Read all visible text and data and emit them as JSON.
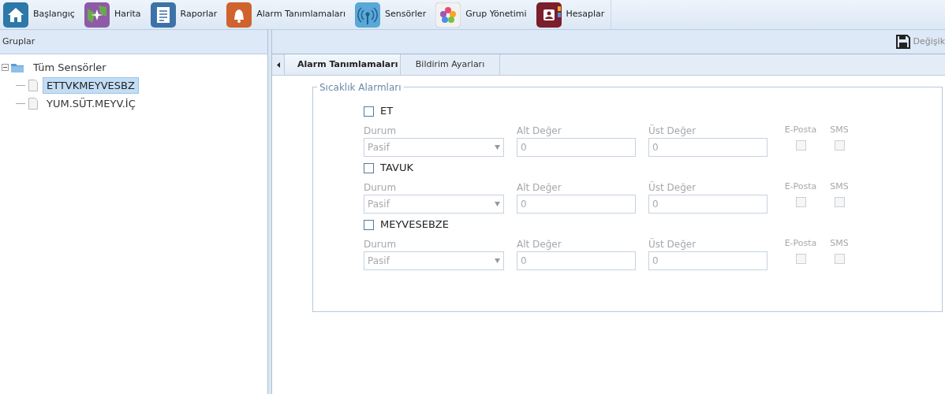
{
  "toolbar": [
    {
      "label": "Başlangıç"
    },
    {
      "label": "Harita"
    },
    {
      "label": "Raporlar"
    },
    {
      "label": "Alarm Tanımlamaları"
    },
    {
      "label": "Sensörler"
    },
    {
      "label": "Grup Yönetimi"
    },
    {
      "label": "Hesaplar"
    }
  ],
  "sidebar": {
    "title": "Gruplar",
    "tree": [
      {
        "label": "Tüm Sensörler",
        "expanded": true,
        "selected": false,
        "children": [
          {
            "label": "ETTVKMEYVESBZ",
            "selected": true
          },
          {
            "label": "YUM.SÜT.MEYV.İÇ",
            "selected": false
          }
        ]
      }
    ]
  },
  "main": {
    "save_button": "Değişik",
    "tabs": [
      {
        "label": "Alarm Tanımlamaları",
        "selected": true
      },
      {
        "label": "Bildirim Ayarları",
        "selected": false
      }
    ],
    "fieldset": {
      "legend": "Sıcaklık Alarmları",
      "groups": [
        {
          "name": "ET",
          "checked": false,
          "disabled": true,
          "status_label": "Durum",
          "status": "Pasif",
          "low_label": "Alt Değer",
          "low": "0",
          "high_label": "Üst Değer",
          "high": "0",
          "email_label": "E-Posta",
          "email": false,
          "sms_label": "SMS",
          "sms": false
        },
        {
          "name": "TAVUK",
          "checked": false,
          "disabled": true,
          "status_label": "Durum",
          "status": "Pasif",
          "low_label": "Alt Değer",
          "low": "0",
          "high_label": "Üst Değer",
          "high": "0",
          "email_label": "E-Posta",
          "email": false,
          "sms_label": "SMS",
          "sms": false
        },
        {
          "name": "MEYVESEBZE",
          "checked": false,
          "disabled": true,
          "status_label": "Durum",
          "status": "Pasif",
          "low_label": "Alt Değer",
          "low": "0",
          "high_label": "Üst Değer",
          "high": "0",
          "email_label": "E-Posta",
          "email": false,
          "sms_label": "SMS",
          "sms": false
        }
      ]
    }
  }
}
